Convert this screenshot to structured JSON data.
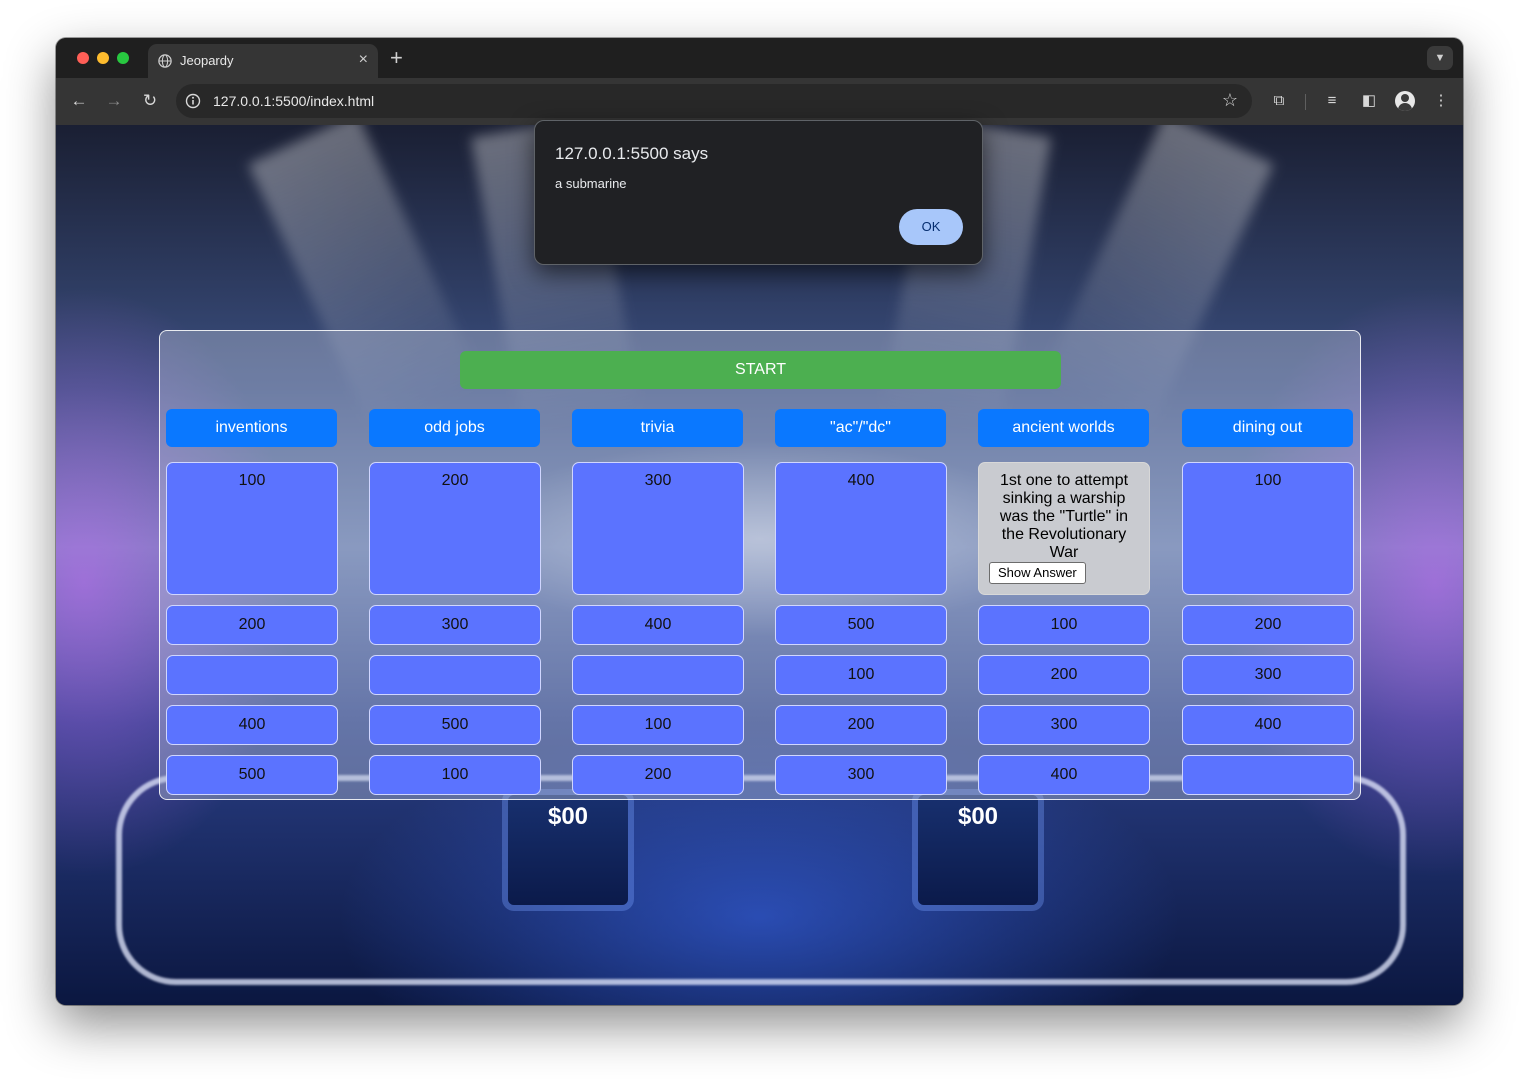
{
  "browser": {
    "tab_title": "Jeopardy",
    "tab_close": "×",
    "new_tab": "+",
    "url": "127.0.0.1:5500/index.html"
  },
  "alert": {
    "title": "127.0.0.1:5500 says",
    "message": "a submarine",
    "ok_label": "OK"
  },
  "game": {
    "start_label": "START",
    "podium_left": "$00",
    "podium_right": "$00",
    "show_answer_label": "Show Answer",
    "question_text": "1st one to attempt sinking a warship was the \"Turtle\" in the Revolutionary War",
    "columns": [
      {
        "category": "inventions",
        "cells": [
          "100",
          "200",
          "",
          "400",
          "500"
        ]
      },
      {
        "category": "odd jobs",
        "cells": [
          "200",
          "300",
          "",
          "500",
          "100"
        ]
      },
      {
        "category": "trivia",
        "cells": [
          "300",
          "400",
          "",
          "100",
          "200"
        ]
      },
      {
        "category": "\"ac\"/\"dc\"",
        "cells": [
          "400",
          "500",
          "100",
          "200",
          "300"
        ]
      },
      {
        "category": "ancient worlds",
        "cells": [
          "",
          "100",
          "200",
          "300",
          "400"
        ]
      },
      {
        "category": "dining out",
        "cells": [
          "100",
          "200",
          "300",
          "400",
          ""
        ]
      }
    ]
  }
}
